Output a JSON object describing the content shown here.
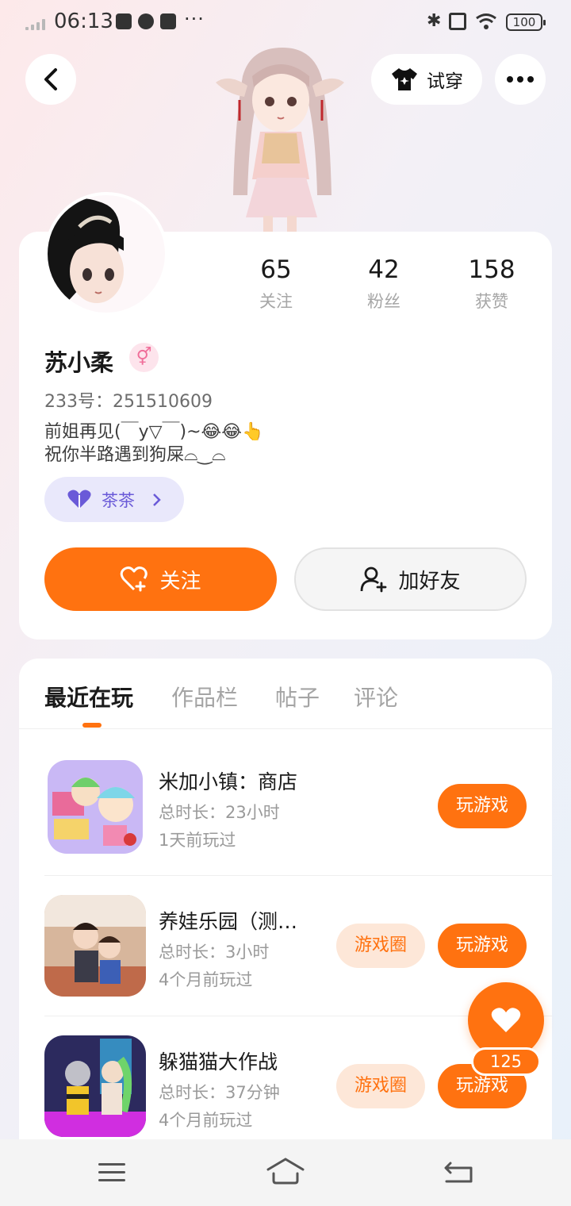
{
  "status_bar": {
    "time": "06:13",
    "more": "···",
    "bluetooth": "✱",
    "wifi": "◠",
    "battery": "100"
  },
  "header": {
    "tryon_label": "试穿"
  },
  "profile": {
    "stats": [
      {
        "value": "65",
        "label": "关注"
      },
      {
        "value": "42",
        "label": "粉丝"
      },
      {
        "value": "158",
        "label": "获赞"
      }
    ],
    "name": "苏小柔",
    "gender_symbol": "⚥",
    "id_line": "233号：251510609",
    "bio_line1": "前姐再见(￣y▽￣)~😂😂👆",
    "bio_line2": "祝你半路遇到狗屎⌓‿⌓",
    "tag": "茶茶",
    "follow_label": "关注",
    "friend_label": "加好友"
  },
  "tabs": [
    "最近在玩",
    "作品栏",
    "帖子",
    "评论"
  ],
  "games": [
    {
      "title": "米加小镇：商店",
      "duration": "总时长：23小时",
      "last_played": "1天前玩过",
      "play_label": "玩游戏"
    },
    {
      "title": "养娃乐园（测…",
      "duration": "总时长：3小时",
      "last_played": "4个月前玩过",
      "circle_label": "游戏圈",
      "play_label": "玩游戏"
    },
    {
      "title": "躲猫猫大作战",
      "duration": "总时长：37分钟",
      "last_played": "4个月前玩过",
      "circle_label": "游戏圈",
      "play_label": "玩游戏"
    }
  ],
  "float_like": {
    "count": "125"
  },
  "colors": {
    "accent": "#ff7210",
    "tag_bg": "#e9e8fb",
    "tag_text": "#6a5ad8"
  }
}
